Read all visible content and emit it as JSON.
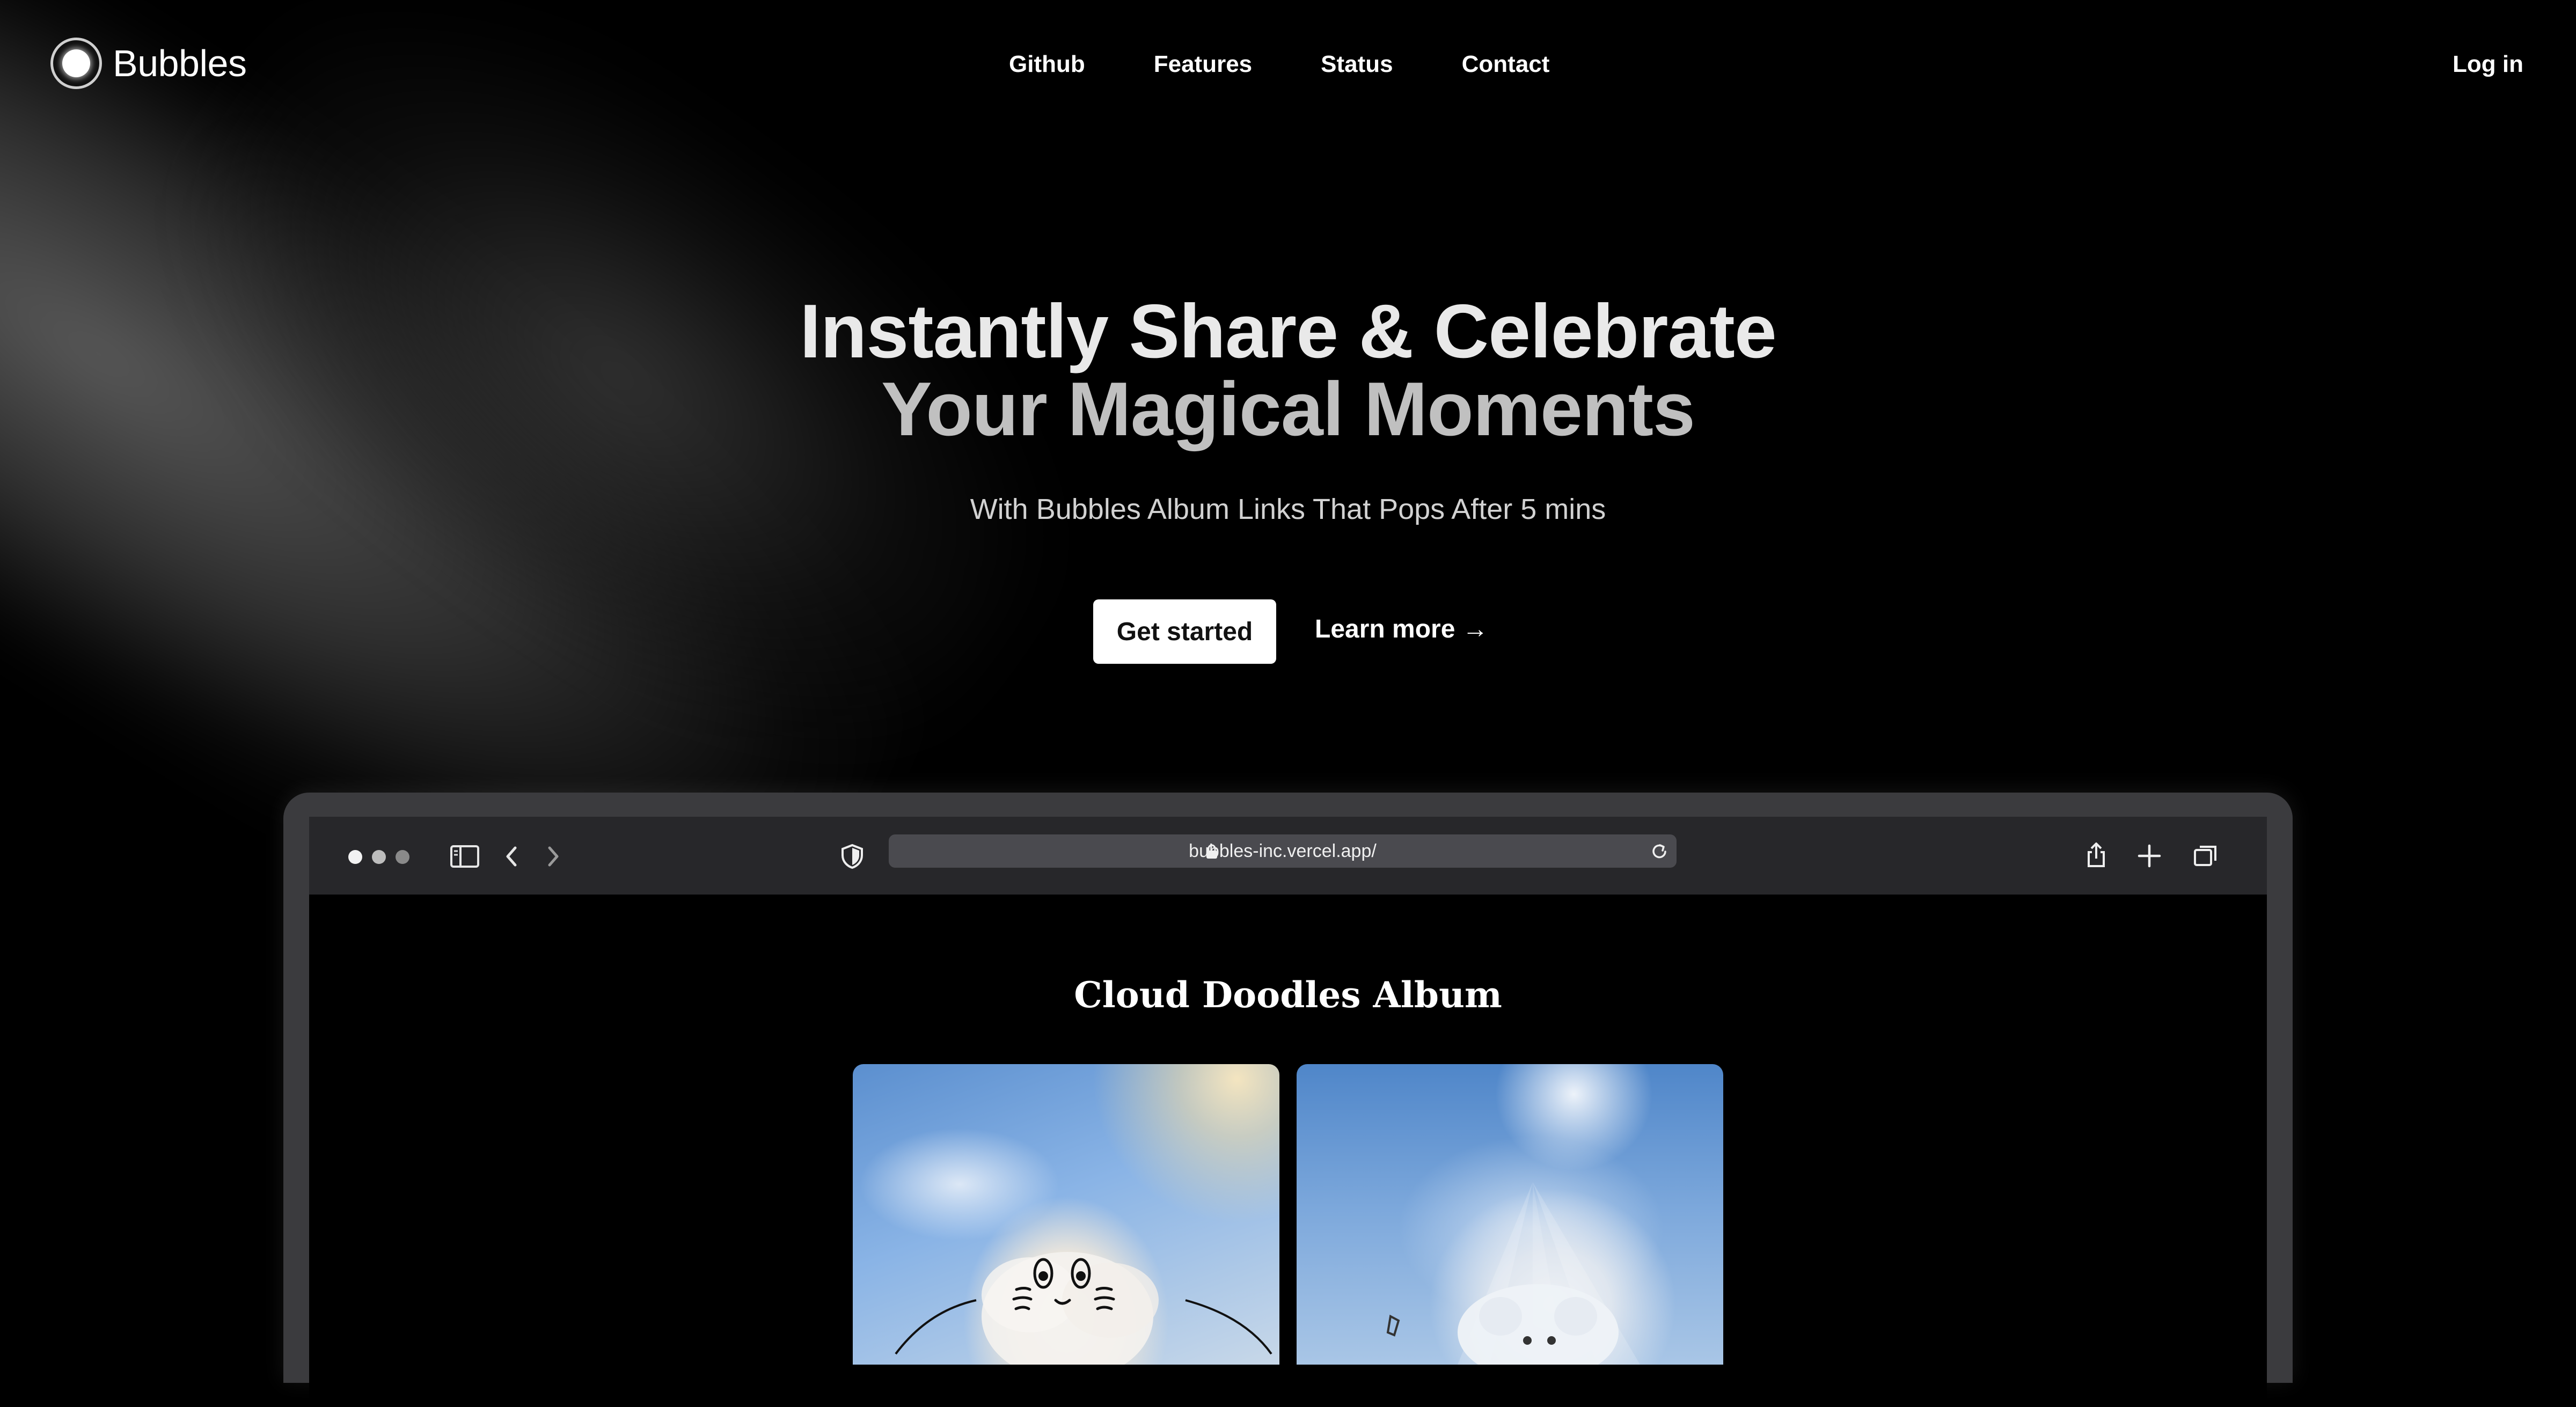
{
  "brand": {
    "name": "Bubbles"
  },
  "nav": {
    "links": [
      "Github",
      "Features",
      "Status",
      "Contact"
    ],
    "login": "Log in"
  },
  "hero": {
    "title_line1": "Instantly Share & Celebrate",
    "title_line2": "Your Magical Moments",
    "subtitle": "With Bubbles Album Links That Pops After 5 mins",
    "primary_cta": "Get started",
    "secondary_cta": "Learn more →"
  },
  "browser": {
    "url": "bubbles-inc.vercel.app/",
    "icons": [
      "sidebar-icon",
      "back-icon",
      "forward-icon",
      "shield-icon",
      "lock-icon",
      "reload-icon",
      "share-icon",
      "new-tab-icon",
      "tabs-overview-icon"
    ],
    "album_title": "Cloud Doodles Album"
  },
  "colors": {
    "background": "#000000",
    "cta_bg": "#ffffff",
    "cta_text": "#111111",
    "toolbar": "#27272a",
    "frame": "#3b3b3e"
  }
}
